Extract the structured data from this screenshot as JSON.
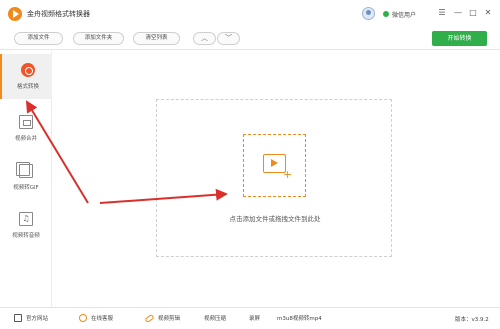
{
  "window": {
    "title": "金舟视频格式转换器",
    "user_name": "微信用户",
    "controls": [
      "☰",
      "—",
      "□",
      "✕"
    ]
  },
  "toolbar": {
    "add_file": "添加文件",
    "add_folder": "添加文件夹",
    "clear_list": "清空列表",
    "move_up": "︿",
    "move_down": "﹀",
    "start_convert": "开始转换"
  },
  "sidebar": {
    "items": [
      {
        "label": "格式转换",
        "icon": "format-convert-icon",
        "active": true
      },
      {
        "label": "视频合并",
        "icon": "video-merge-icon",
        "active": false
      },
      {
        "label": "视频转GIF",
        "icon": "video-to-gif-icon",
        "active": false
      },
      {
        "label": "视频转音频",
        "icon": "video-to-audio-icon",
        "active": false
      }
    ]
  },
  "main": {
    "drop_hint": "点击添加文件或拖拽文件到此处"
  },
  "footer": {
    "official_site": "官方网站",
    "online_service": "在线客服",
    "video_edit": "视频剪辑",
    "video_compress": "视频压缩",
    "screen_record": "录屏",
    "m3u8_convert": "m3u8视频转mp4",
    "version": "版本：v3.9.2"
  },
  "annotation": {
    "arrow_color": "#d9302c"
  },
  "colors": {
    "accent": "#f08a1c",
    "start_button": "#2fae4a"
  }
}
